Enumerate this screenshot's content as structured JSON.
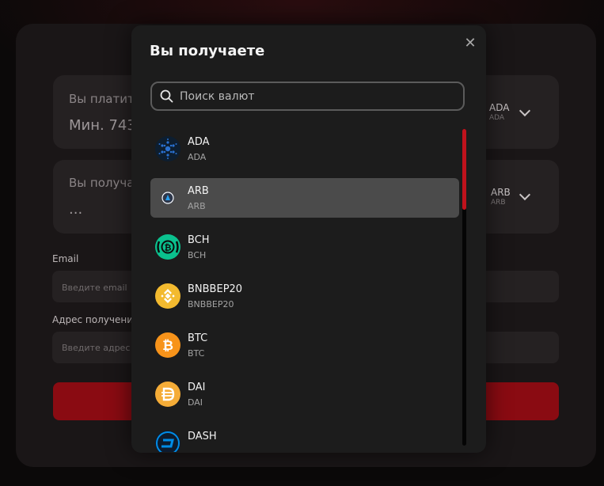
{
  "background": {
    "pay_label": "Вы платите",
    "pay_value": "Мин. 743",
    "pay_currency": "ADA",
    "pay_currency_sub": "ADA",
    "receive_label": "Вы получаете",
    "receive_value": "...",
    "receive_currency": "ARB",
    "receive_currency_sub": "ARB",
    "email_label": "Email",
    "email_placeholder": "Введите email",
    "address_label": "Адрес получения",
    "address_placeholder": "Введите адрес получения",
    "accent_color": "#8a0b12"
  },
  "modal": {
    "title": "Вы получаете",
    "close_glyph": "✕",
    "search_placeholder": "Поиск валют",
    "items": [
      {
        "name": "ADA",
        "code": "ADA",
        "icon": "cardano-icon",
        "color": "#0d1e30",
        "selected": false
      },
      {
        "name": "ARB",
        "code": "ARB",
        "icon": "arbitrum-icon",
        "color": "#2d374b",
        "selected": true
      },
      {
        "name": "BCH",
        "code": "BCH",
        "icon": "bitcoin-cash-icon",
        "color": "#0ac18e",
        "selected": false
      },
      {
        "name": "BNBBEP20",
        "code": "BNBBEP20",
        "icon": "bnb-icon",
        "color": "#f3ba2f",
        "selected": false
      },
      {
        "name": "BTC",
        "code": "BTC",
        "icon": "bitcoin-icon",
        "color": "#f7931a",
        "selected": false
      },
      {
        "name": "DAI",
        "code": "DAI",
        "icon": "dai-icon",
        "color": "#f5ac37",
        "selected": false
      },
      {
        "name": "DASH",
        "code": "",
        "icon": "dash-icon",
        "color": "#008ce7",
        "selected": false
      }
    ],
    "scroll_accent": "#c0121c"
  }
}
